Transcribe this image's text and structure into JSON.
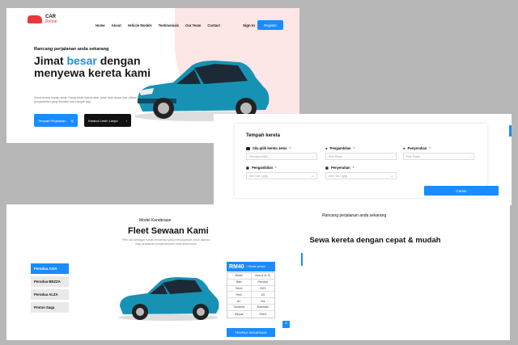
{
  "hero": {
    "logo_title": "CAR",
    "logo_subtitle": "Rental",
    "nav": [
      "Home",
      "About",
      "Vehicle Models",
      "Testimonials",
      "Our Team",
      "Contact"
    ],
    "signin_label": "Sign In",
    "register_label": "Register",
    "tagline": "Rancang perjalanan anda sekarang",
    "headline_1": "Jimat ",
    "headline_highlight": "besar",
    "headline_2": " dengan menyewa kereta kami",
    "description": "Sewa kereta impian anda. Harga tidak masuk akal, jarak batu tanpa had, pilihan pengambilan yang fleksibel dan banyak lagi.",
    "book_button": "Tempah Perjalanan",
    "more_button": "Ketahui Lebih Lanjut",
    "accent_color": "#1a8cff"
  },
  "booking": {
    "title": "Tempah kereta",
    "car_type_label": "Sila pilih kereta Jenis",
    "car_type_value": "Perodua AXIA",
    "pickup_label": "Pengambilan",
    "pickup_value": "Pick Place",
    "dropoff_label": "Penyerahan",
    "dropoff_value": "Pick Place",
    "pickup_date_label": "Pengambilan",
    "pickup_date_value": "mm / dd / yyyy",
    "dropoff_date_label": "Penyerahan",
    "dropoff_date_value": "mm / dd / yyyy",
    "search_label": "Carian",
    "required_mark": "*"
  },
  "fleet": {
    "subtitle": "Model Kenderaan",
    "title": "Fleet Sewaan Kami",
    "description": "Pilih dari pelbagai model kenderaan yang menakjubkan untuk dibawa bagi perjalanan pengembaraan anda seterusnya",
    "tabs": [
      "Perodua AXIA",
      "Perodua BEZZA",
      "Perodua ALZA",
      "Proton Saga"
    ],
    "price": "RM40",
    "price_unit": "/ Sewa sehari",
    "specs": [
      [
        "Model",
        "Axia (1.0L E)"
      ],
      [
        "Mark",
        "Perodua"
      ],
      [
        "Tahun",
        "2023"
      ],
      [
        "Pintu",
        "4/5"
      ],
      [
        "AC",
        "Yes"
      ],
      [
        "Transmisi",
        "Automatic"
      ],
      [
        "Minyak",
        "Petrol"
      ]
    ],
    "book_now": "TEMPAH SEKARANG",
    "scroll_top_icon": "^"
  },
  "plan": {
    "subtitle": "Rancang perjalanan anda sekarang",
    "title": "Sewa kereta dengan cepat & mudah"
  }
}
